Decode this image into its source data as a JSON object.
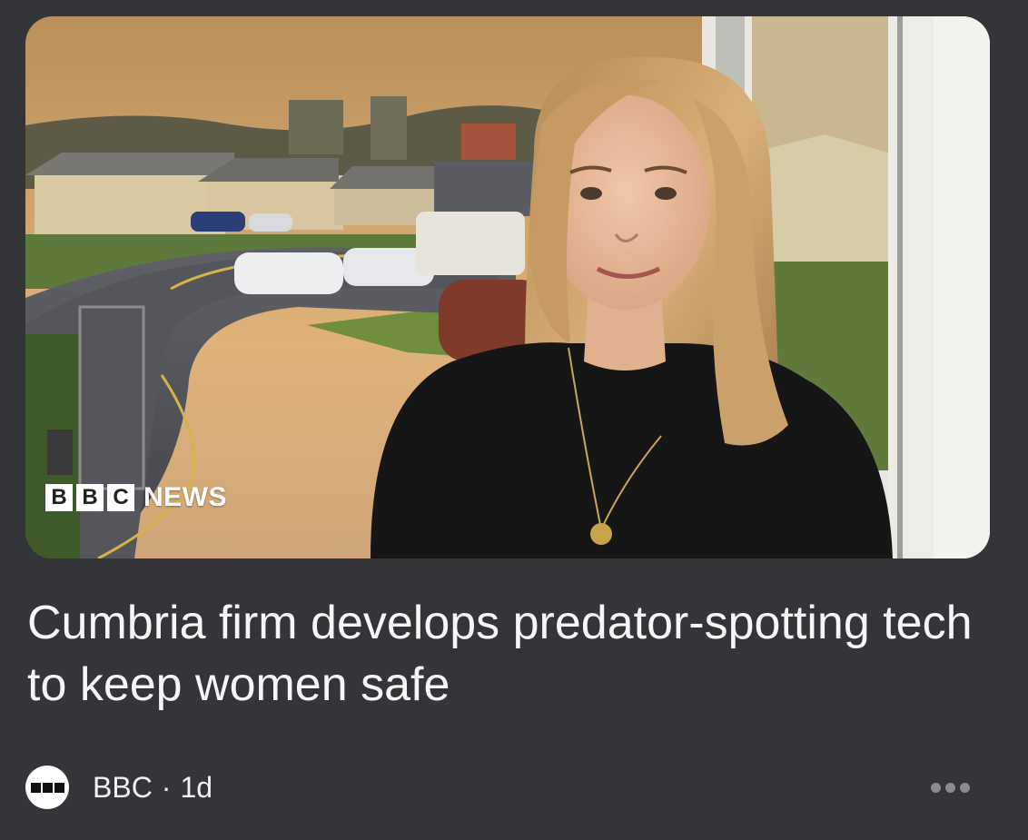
{
  "article": {
    "headline": "Cumbria firm develops predator-spotting tech to keep women safe",
    "image_watermark": {
      "letters": [
        "B",
        "B",
        "C"
      ],
      "word": "NEWS"
    }
  },
  "source": {
    "logo_icon": "bbc-logo-icon",
    "name": "BBC",
    "separator": "·",
    "time": "1d"
  },
  "actions": {
    "more_icon": "ellipsis-icon"
  },
  "colors": {
    "background": "#343538",
    "text": "#f6f6f6",
    "more_dots": "#8c8c90"
  }
}
